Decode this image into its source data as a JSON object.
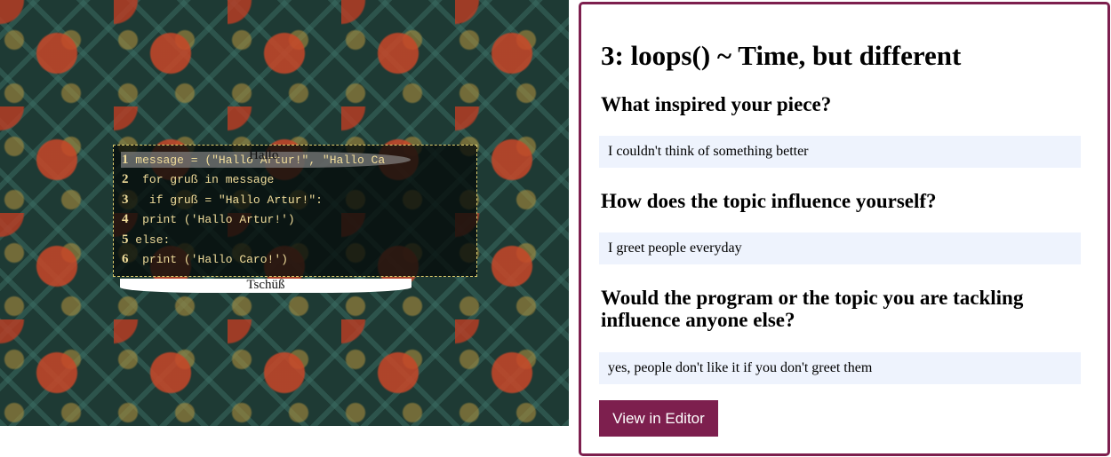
{
  "sketch": {
    "code_lines": [
      {
        "n": "1",
        "text": " message = (\"Hallo Artur!\", \"Hallo Ca"
      },
      {
        "n": "2",
        "text": "  for gruß in message"
      },
      {
        "n": "3",
        "text": "   if gruß = \"Hallo Artur!\":"
      },
      {
        "n": "4",
        "text": "  print ('Hallo Artur!')"
      },
      {
        "n": "5",
        "text": " else:"
      },
      {
        "n": "6",
        "text": "  print ('Hallo Caro!')"
      }
    ],
    "greeting_top": "Hallo",
    "greeting_bottom": "Tschüß"
  },
  "panel": {
    "title": "3: loops() ~ Time, but different",
    "questions": [
      {
        "q": "What inspired your piece?",
        "a": "I couldn't think of something better"
      },
      {
        "q": "How does the topic influence yourself?",
        "a": "I greet people everyday"
      },
      {
        "q": "Would the program or the topic you are tackling influence anyone else?",
        "a": "yes, people don't like it if you don't greet them"
      }
    ],
    "button": "View in Editor",
    "accent": "#7d1f4e"
  }
}
